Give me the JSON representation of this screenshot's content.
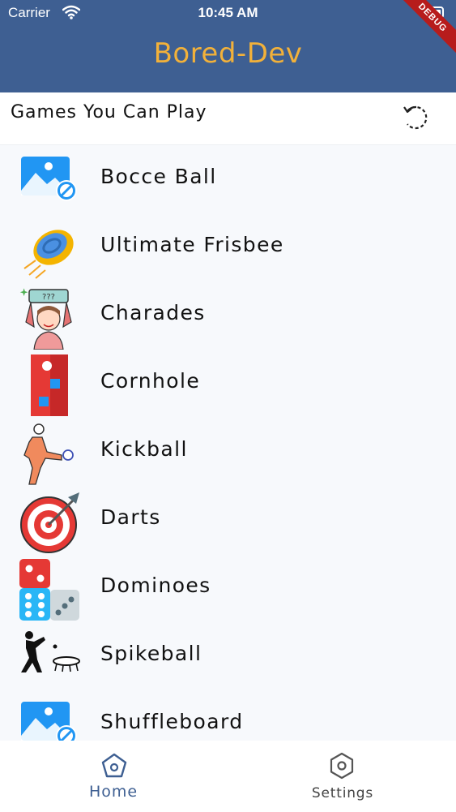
{
  "status_bar": {
    "carrier": "Carrier",
    "time": "10:45 AM"
  },
  "app_bar": {
    "title": "Bored-Dev",
    "debug_label": "DEBUG"
  },
  "header": {
    "title": "Games You Can Play"
  },
  "games": [
    {
      "label": "Bocce Ball",
      "icon": "broken-image-icon"
    },
    {
      "label": "Ultimate Frisbee",
      "icon": "frisbee-icon"
    },
    {
      "label": "Charades",
      "icon": "charades-icon"
    },
    {
      "label": "Cornhole",
      "icon": "cornhole-icon"
    },
    {
      "label": "Kickball",
      "icon": "kickball-icon"
    },
    {
      "label": "Darts",
      "icon": "dartboard-icon"
    },
    {
      "label": "Dominoes",
      "icon": "dominoes-icon"
    },
    {
      "label": "Spikeball",
      "icon": "spikeball-icon"
    },
    {
      "label": "Shuffleboard",
      "icon": "broken-image-icon"
    }
  ],
  "nav": {
    "home_label": "Home",
    "settings_label": "Settings"
  },
  "colors": {
    "app_bar": "#3e5f92",
    "title": "#f2b13a",
    "active_tab": "#3e5f92",
    "background": "#f7f9fc"
  }
}
